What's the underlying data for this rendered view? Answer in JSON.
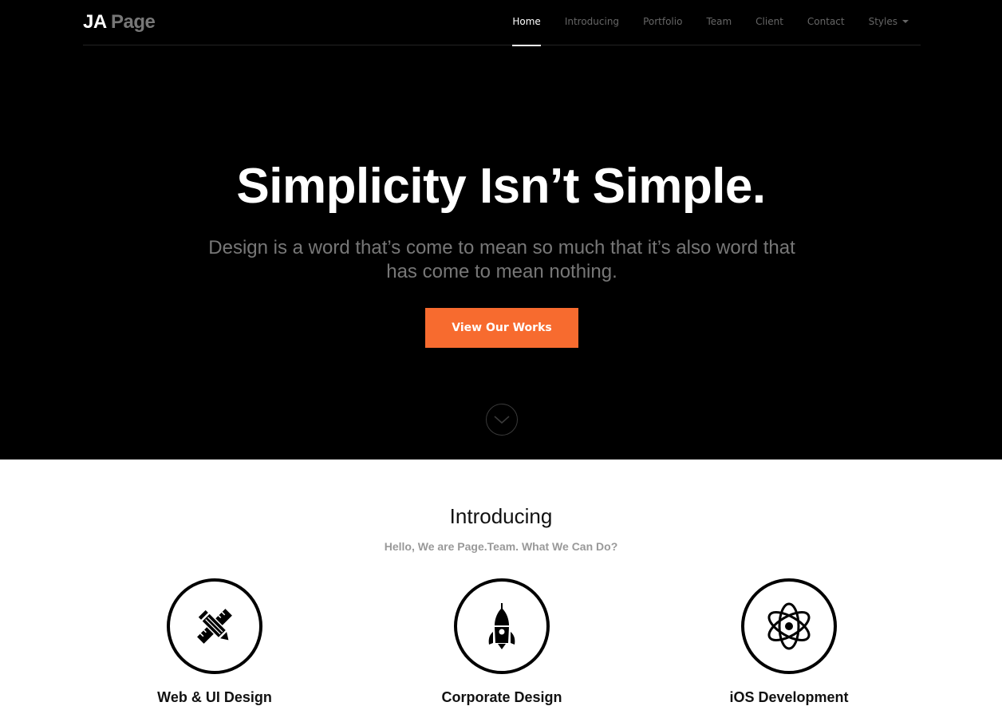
{
  "brand": {
    "part1": "JA",
    "part2": "Page"
  },
  "nav": {
    "items": [
      {
        "label": "Home",
        "active": true
      },
      {
        "label": "Introducing"
      },
      {
        "label": "Portfolio"
      },
      {
        "label": "Team"
      },
      {
        "label": "Client"
      },
      {
        "label": "Contact"
      },
      {
        "label": "Styles",
        "dropdown": true
      }
    ]
  },
  "hero": {
    "title": "Simplicity Isn’t Simple.",
    "subtitle": "Design is a word that’s come to mean so much that it’s also word that has come to mean nothing.",
    "cta_label": "View Our Works",
    "cta_color": "#f76b2f",
    "scroll_icon": "chevron-down-circle-icon"
  },
  "introducing": {
    "title": "Introducing",
    "subtitle": "Hello, We are Page.Team. What We Can Do?",
    "services": [
      {
        "label": "Web & UI Design",
        "icon": "pencil-ruler-icon"
      },
      {
        "label": "Corporate Design",
        "icon": "rocket-icon"
      },
      {
        "label": "iOS Development",
        "icon": "atom-icon"
      }
    ]
  }
}
